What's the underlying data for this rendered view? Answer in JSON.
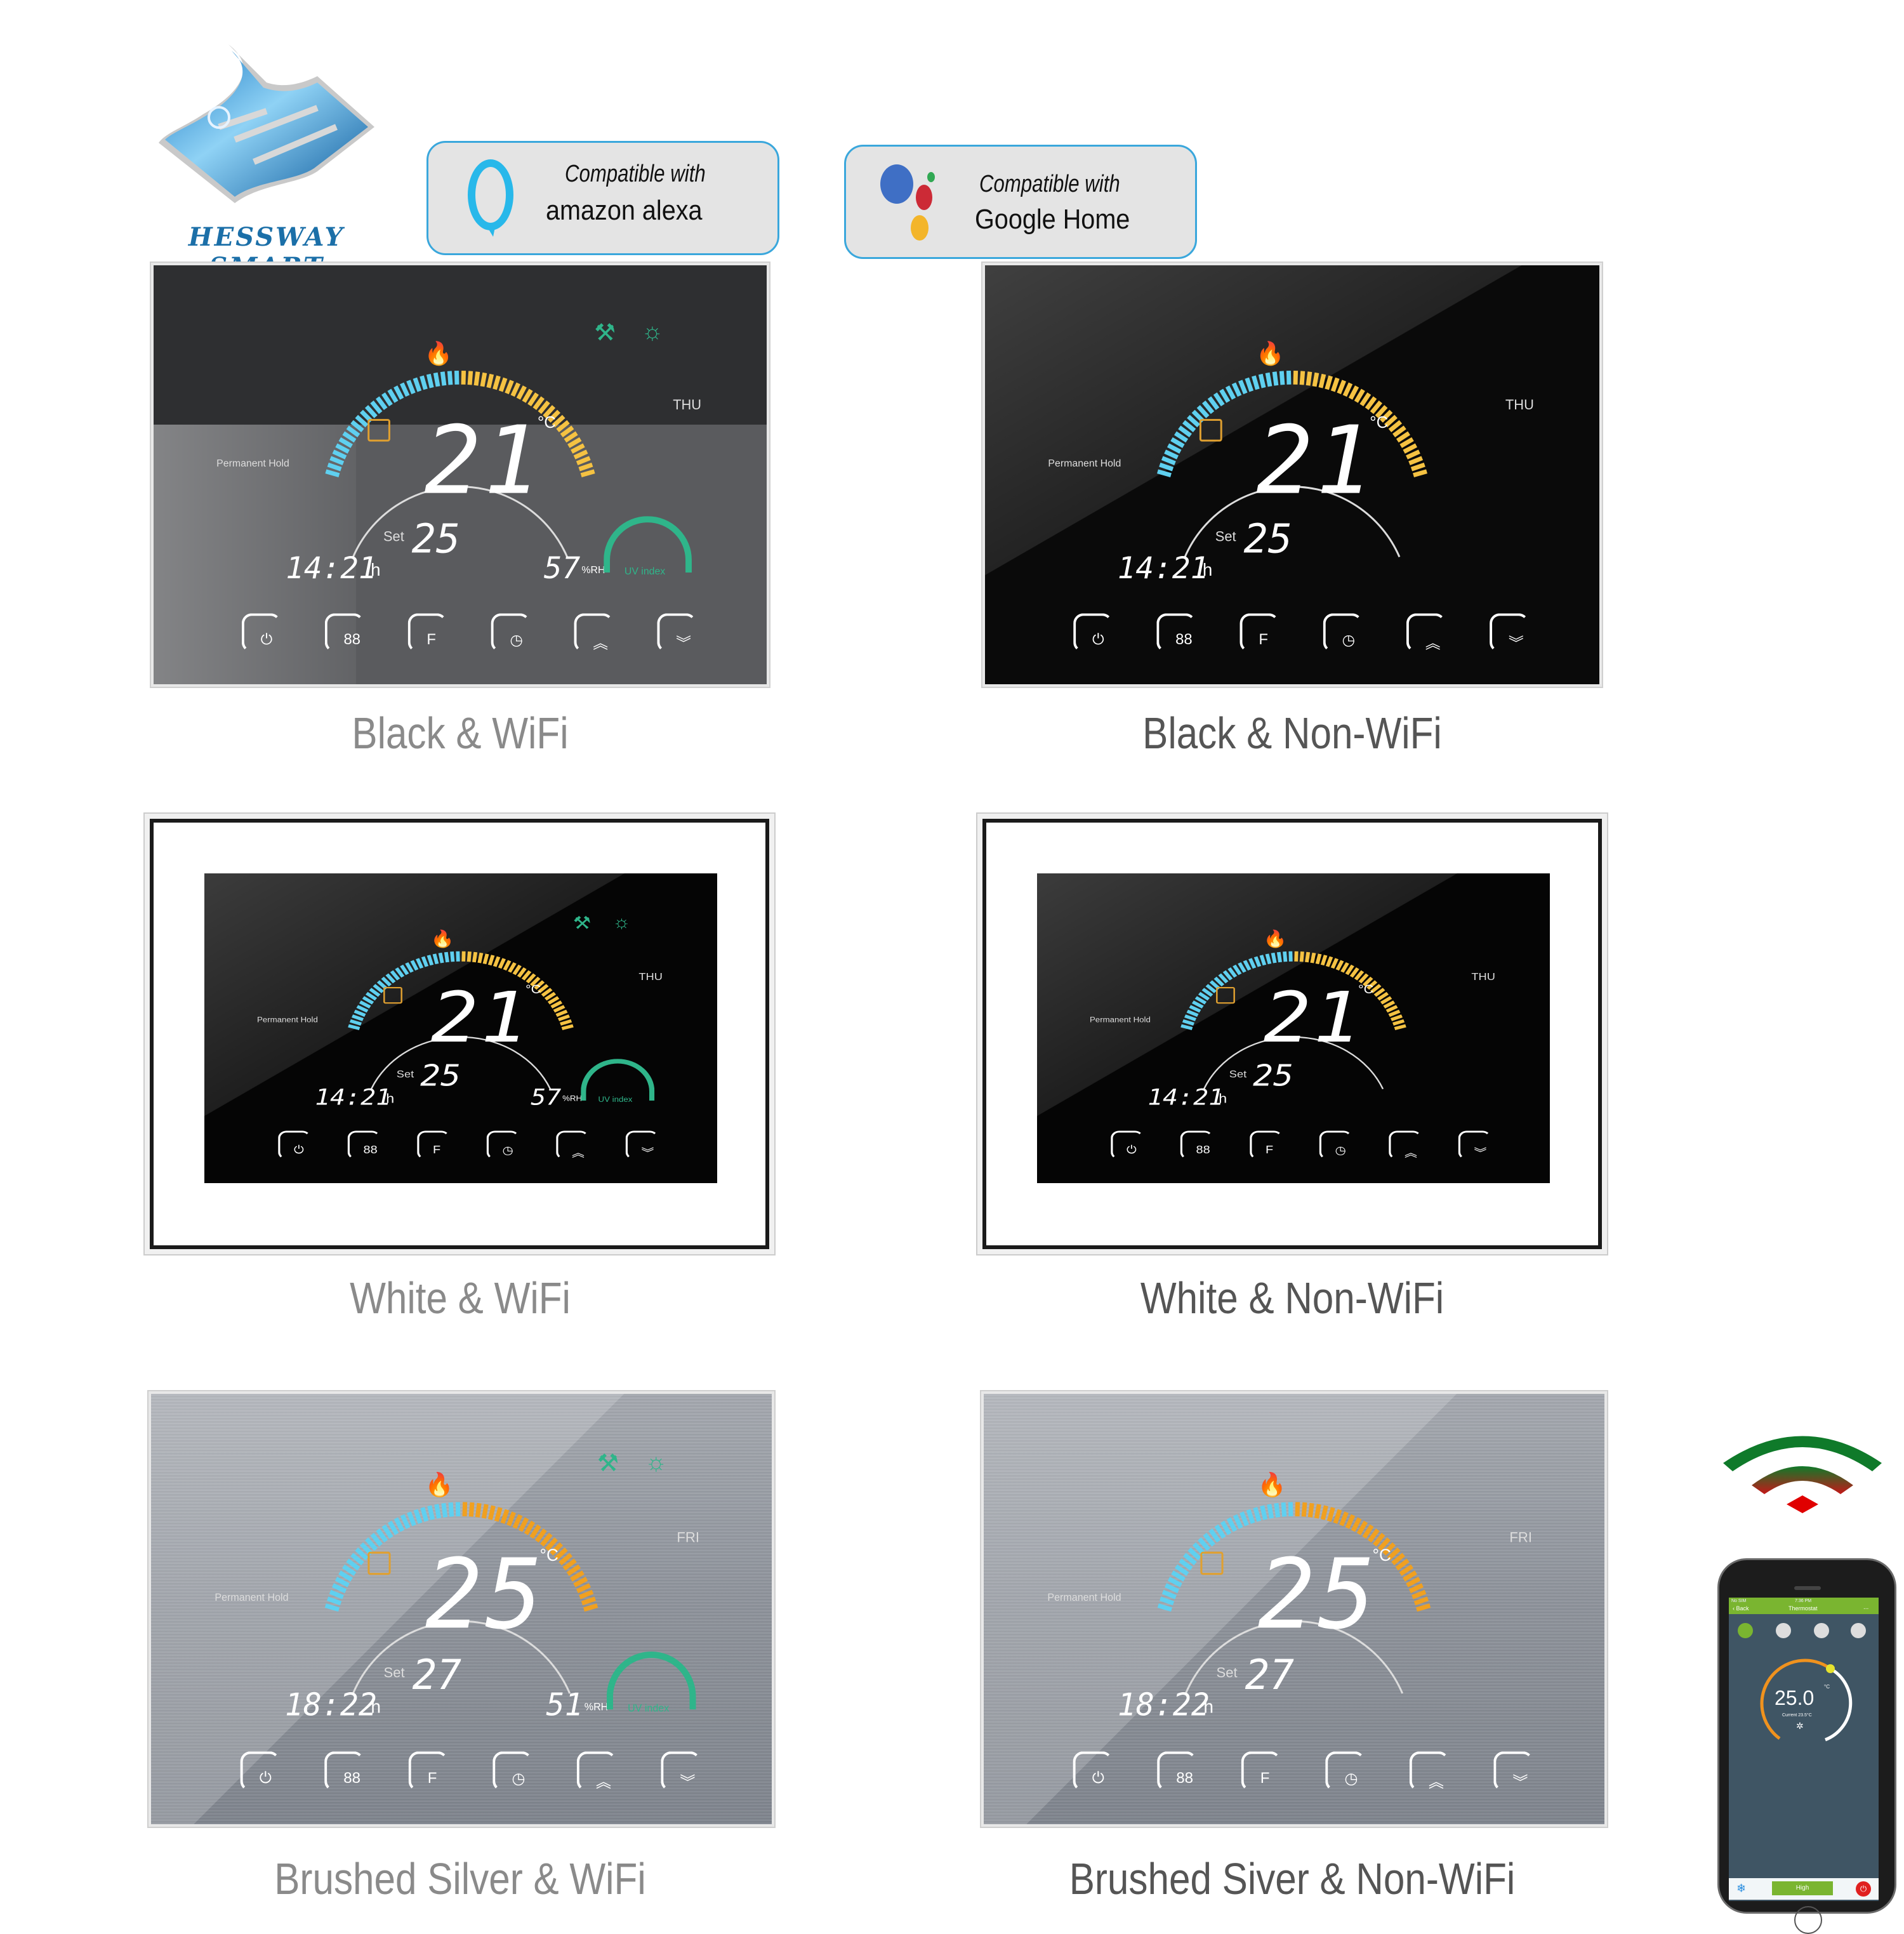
{
  "brand": {
    "name": "HESSWAY SMART",
    "colors": {
      "logo_blue": "#1b6fa8",
      "badge_border": "#3aa7dc"
    }
  },
  "badges": [
    {
      "id": "alexa",
      "line1": "Compatible with",
      "line2": "amazon alexa",
      "icon": "alexa-ring-icon",
      "icon_color": "#28b8ea"
    },
    {
      "id": "google",
      "line1": "Compatible with",
      "line2": "Google Home",
      "icon": "google-assistant-dots-icon",
      "dot_colors": [
        "#3f6fc5",
        "#cc2a36",
        "#f3b52a",
        "#31a853"
      ]
    }
  ],
  "display": {
    "mode_label": "Permanent Hold",
    "set_label": "Set",
    "humidity_unit": "%RH",
    "uv_label": "UV index",
    "temp_unit": "°C",
    "time_suffix": "h",
    "buttons": [
      {
        "name": "power",
        "icon": "power-icon",
        "glyph": "⏻"
      },
      {
        "name": "mode",
        "icon": "mode-88-icon",
        "glyph": "88"
      },
      {
        "name": "fan",
        "icon": "fan-f-icon",
        "glyph": "F"
      },
      {
        "name": "schedule",
        "icon": "clock-icon",
        "glyph": "◷"
      },
      {
        "name": "up",
        "icon": "chevron-up-double-icon",
        "glyph": "︽"
      },
      {
        "name": "down",
        "icon": "chevron-down-double-icon",
        "glyph": "︾"
      }
    ],
    "arc_colors": {
      "cool": "#5fd0f0",
      "warm": "#f5c242",
      "warm_silver": "#f0a020"
    }
  },
  "products": [
    {
      "label": "Black & WiFi",
      "finish": "black",
      "wifi": true,
      "temp": "21",
      "set": "25",
      "time": "14:21",
      "day": "THU",
      "humidity": "57"
    },
    {
      "label": "Black & Non-WiFi",
      "finish": "black",
      "wifi": false,
      "temp": "21",
      "set": "25",
      "time": "14:21",
      "day": "THU"
    },
    {
      "label": "White & WiFi",
      "finish": "white",
      "wifi": true,
      "temp": "21",
      "set": "25",
      "time": "14:21",
      "day": "THU",
      "humidity": "57"
    },
    {
      "label": "White & Non-WiFi",
      "finish": "white",
      "wifi": false,
      "temp": "21",
      "set": "25",
      "time": "14:21",
      "day": "THU"
    },
    {
      "label": "Brushed Silver & WiFi",
      "finish": "silver",
      "wifi": true,
      "temp": "25",
      "set": "27",
      "time": "18:22",
      "day": "FRI",
      "humidity": "51"
    },
    {
      "label": "Brushed Siver & Non-WiFi",
      "finish": "silver",
      "wifi": false,
      "temp": "25",
      "set": "27",
      "time": "18:22",
      "day": "FRI"
    }
  ],
  "wifi_symbol": {
    "colors": [
      "#0f7a2a",
      "#c41818",
      "#e00000"
    ]
  },
  "phone_app": {
    "status_left": "No SIM",
    "status_time": "7:36 PM",
    "back_label": "Back",
    "title": "Thermostat",
    "menu_label": "...",
    "set_temp": "25.0",
    "unit": "°C",
    "current_label": "Current 23.5°C",
    "fan_label": "High",
    "accent": "#7ab530",
    "dial_color": "#f0921e",
    "power_color": "#e02020",
    "mode_icons": [
      "hand-manual-icon",
      "home-program-icon",
      "leaf-eco-icon",
      "lock-icon"
    ]
  }
}
